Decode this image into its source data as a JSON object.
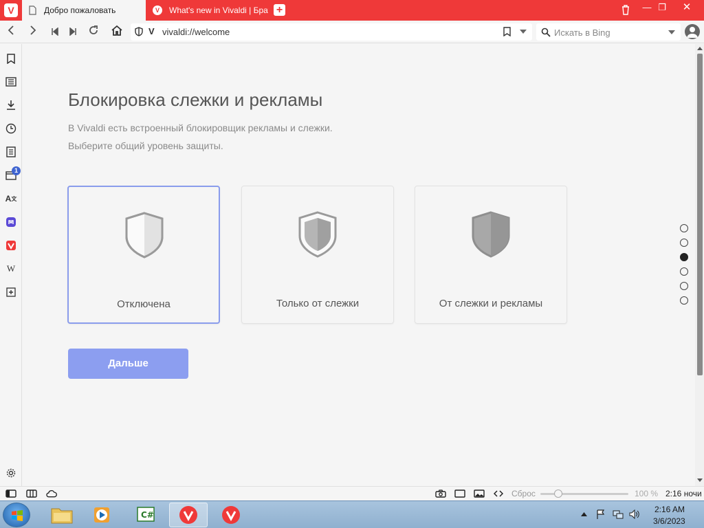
{
  "browser": {
    "tabs": [
      {
        "label": "Добро пожаловать",
        "active": true
      },
      {
        "label": "What's new in Vivaldi | Браузер Vivaldi",
        "active": false
      }
    ],
    "url": "vivaldi://welcome",
    "search_placeholder": "Искать в Bing",
    "accent_color": "#ef3939"
  },
  "sidepanel": {
    "badge_count": "1"
  },
  "page": {
    "title": "Блокировка слежки и рекламы",
    "subtitle_line1": "В Vivaldi есть встроенный блокировщик рекламы и слежки.",
    "subtitle_line2": "Выберите общий уровень защиты.",
    "options": [
      {
        "label": "Отключена",
        "selected": true
      },
      {
        "label": "Только от слежки",
        "selected": false
      },
      {
        "label": "От слежки и рекламы",
        "selected": false
      }
    ],
    "next_button": "Дальше",
    "button_color": "#8c9ef0",
    "pager_steps": 6,
    "pager_current": 3
  },
  "statusbar": {
    "reset_label": "Сброс",
    "zoom": "100 %",
    "clock": "2:16 ночи"
  },
  "taskbar": {
    "time": "2:16 AM",
    "date": "3/6/2023"
  }
}
